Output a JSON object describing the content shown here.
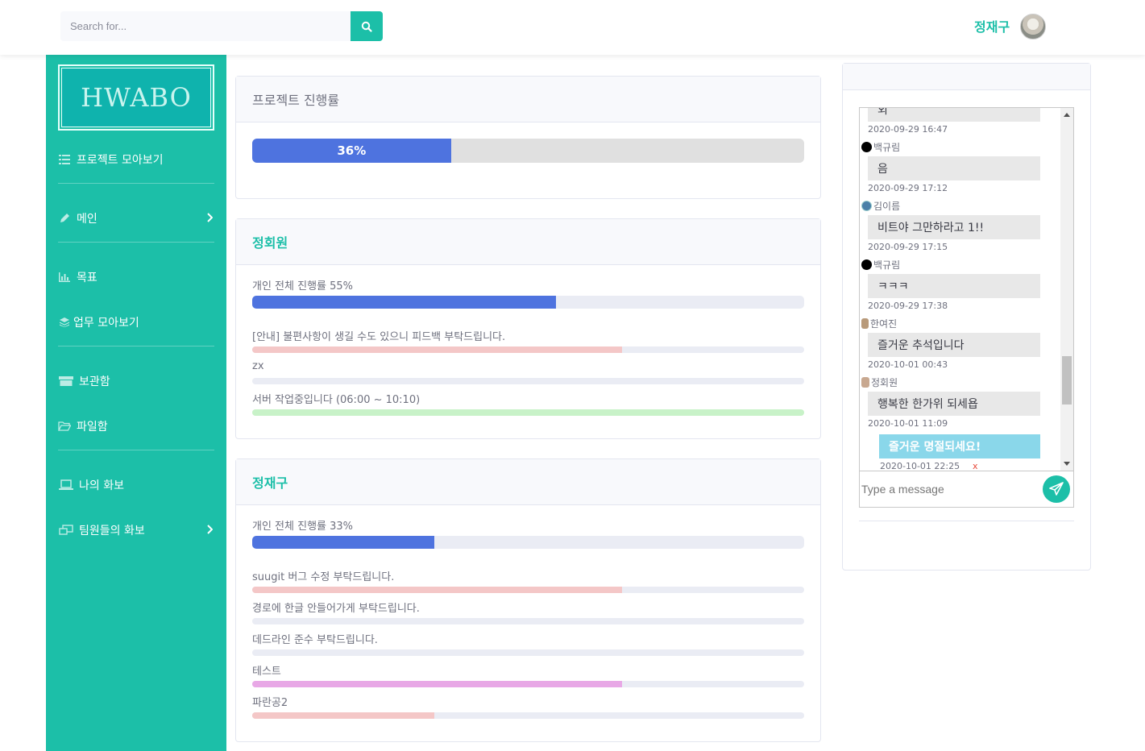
{
  "search": {
    "placeholder": "Search for..."
  },
  "user": {
    "name": "정재구"
  },
  "sidebar": {
    "logo": "HWABO",
    "items": [
      {
        "label": "프로젝트 모아보기",
        "icon": "list-icon"
      },
      {
        "label": "메인",
        "icon": "pencil-icon"
      },
      {
        "label": "목표",
        "icon": "chart-icon"
      },
      {
        "label": "업무 모아보기",
        "icon": "layers-icon"
      },
      {
        "label": "보관함",
        "icon": "box-icon"
      },
      {
        "label": "파일함",
        "icon": "folder-icon"
      },
      {
        "label": "나의 화보",
        "icon": "laptop-icon"
      },
      {
        "label": "팀원들의 화보",
        "icon": "desktop-icon"
      }
    ]
  },
  "project": {
    "title": "프로젝트 진행률",
    "percent": 36,
    "percent_label": "36%"
  },
  "members": [
    {
      "name": "정회원",
      "overall_label": "개인 전체 진행률 55%",
      "overall": 55,
      "tasks": [
        {
          "label": "[안내] 불편사항이 생길 수도 있으니 피드백 부탁드립니다.",
          "progress": 67,
          "color": "#f4c7c7"
        },
        {
          "label": "zx",
          "progress": 0,
          "color": "#f4c7c7"
        },
        {
          "label": "서버 작업중입니다 (06:00 ~ 10:10)",
          "progress": 100,
          "color": "#c8f2c8"
        }
      ]
    },
    {
      "name": "정재구",
      "overall_label": "개인 전체 진행률 33%",
      "overall": 33,
      "tasks": [
        {
          "label": "suugit 버그 수정 부탁드립니다.",
          "progress": 67,
          "color": "#f4c7c7"
        },
        {
          "label": "경로에 한글 안들어가게 부탁드립니다.",
          "progress": 0,
          "color": "#f4c7c7"
        },
        {
          "label": "데드라인 준수 부탁드립니다.",
          "progress": 0,
          "color": "#f4c7c7"
        },
        {
          "label": "테스트",
          "progress": 67,
          "color": "#e8a8e6"
        },
        {
          "label": "파란공2",
          "progress": 33,
          "color": "#f4c7c7"
        }
      ]
    }
  ],
  "chat": {
    "input_placeholder": "Type a message",
    "delete_label": "x",
    "messages": [
      {
        "sender": "",
        "text": "외",
        "time": "2020-09-29 16:47",
        "mine": false,
        "avatar_color": ""
      },
      {
        "sender": "백규림",
        "text": "음",
        "time": "2020-09-29 17:12",
        "mine": false,
        "avatar_color": "#000000"
      },
      {
        "sender": "김이름",
        "text": "비트야 그만하라고 1!!",
        "time": "2020-09-29 17:15",
        "mine": false,
        "avatar_color": "#4a7fa8"
      },
      {
        "sender": "백규림",
        "text": "ㅋㅋㅋ",
        "time": "2020-09-29 17:38",
        "mine": false,
        "avatar_color": "#000000"
      },
      {
        "sender": "한여진",
        "text": "즐거운 추석입니다",
        "time": "2020-10-01 00:43",
        "mine": false,
        "avatar_color": "#b89a7a"
      },
      {
        "sender": "정회원",
        "text": "행복한 한가위 되세욥",
        "time": "2020-10-01 11:09",
        "mine": false,
        "avatar_color": "#c8a890"
      },
      {
        "sender": "",
        "text": "즐거운 명절되세요!",
        "time": "2020-10-01 22:25",
        "mine": true,
        "avatar_color": ""
      }
    ]
  },
  "colors": {
    "accent": "#1cbfa8",
    "primary_bar": "#4e73df"
  }
}
